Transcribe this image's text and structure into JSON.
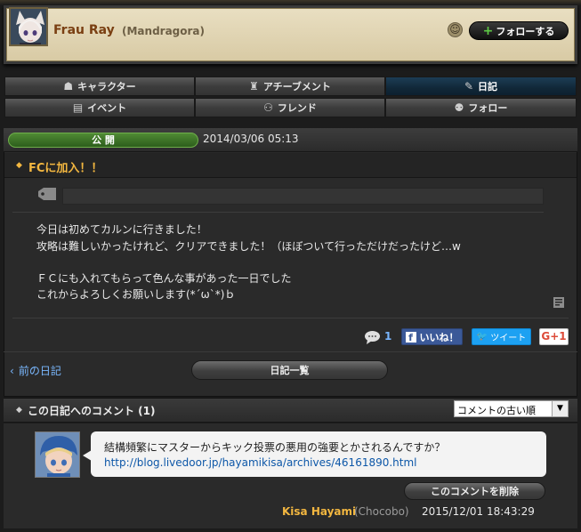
{
  "header": {
    "character_name": "Frau Ray",
    "world": "(Mandragora)",
    "follow_label": "フォローする",
    "follow_plus": "+"
  },
  "tabs": [
    {
      "label": "キャラクター",
      "icon": "character-icon",
      "active": false
    },
    {
      "label": "アチーブメント",
      "icon": "achievement-icon",
      "active": false
    },
    {
      "label": "日記",
      "icon": "diary-icon",
      "active": true
    },
    {
      "label": "イベント",
      "icon": "event-icon",
      "active": false
    },
    {
      "label": "フレンド",
      "icon": "friend-icon",
      "active": false
    },
    {
      "label": "フォロー",
      "icon": "follow-icon",
      "active": false
    }
  ],
  "entry": {
    "status": "公 開",
    "date": "2014/03/06 05:13",
    "title": "FCに加入！！",
    "body_lines": [
      "今日は初めてカルンに行きました！",
      "攻略は難しいかったけれど、クリアできました！（ほぼついて行っただけだったけど…w",
      "",
      "ＦＣにも入れてもらって色んな事があった一日でした",
      "これからよろしくお願いします(*´ω`*)ｂ"
    ],
    "comment_count": "1",
    "like_label": "いいね！",
    "tweet_label": "ツイート",
    "gplus_label": "G+1"
  },
  "nav": {
    "prev_label": "前の日記",
    "list_label": "日記一覧"
  },
  "comments": {
    "title": "この日記へのコメント (1)",
    "sort_value": "コメントの古い順",
    "items": [
      {
        "text": "結構頻繁にマスターからキック投票の悪用の強要とかされるんですか？",
        "link": "http://blog.livedoor.jp/hayamikisa/archives/46161890.html",
        "delete_label": "このコメントを削除",
        "author": "Kisa Hayami",
        "world": "(Chocobo)",
        "date": "2015/12/01 18:43:29"
      }
    ]
  },
  "colors": {
    "accent_gold": "#f3b740",
    "link_blue": "#7ab8ff",
    "active_tab": "#112838",
    "public_green": "#3f7a2a"
  }
}
